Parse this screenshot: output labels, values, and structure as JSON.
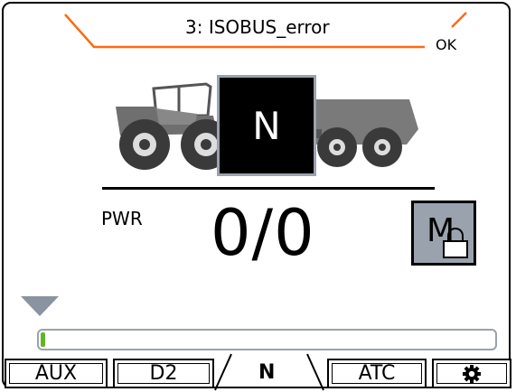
{
  "alarm": {
    "message": "3: ISOBUS_error",
    "ok_label": "OK",
    "accent_color": "#ff6a10"
  },
  "gear_display": {
    "value": "N"
  },
  "power": {
    "label": "PWR",
    "value": "0/0"
  },
  "mode_button": {
    "letter": "M",
    "lock_icon": "padlock-icon",
    "background": "#9aa2ad"
  },
  "progress": {
    "fraction": 0.01,
    "fill_color": "#64b424"
  },
  "tabs": [
    {
      "label": "AUX"
    },
    {
      "label": "D2"
    },
    {
      "label": "N",
      "active": true
    },
    {
      "label": "ATC"
    },
    {
      "icon": "gear-icon"
    }
  ],
  "icons": {
    "vehicle": "tractor-with-trailer-icon",
    "marker": "triangle-down-icon"
  }
}
